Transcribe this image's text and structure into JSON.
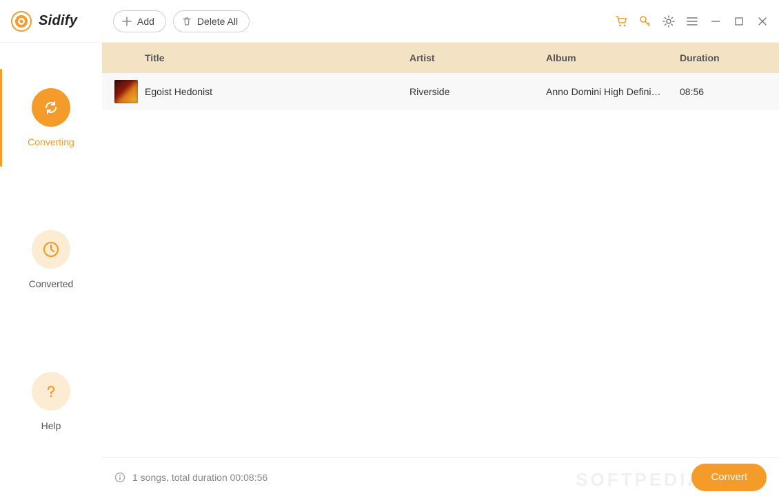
{
  "app": {
    "name": "Sidify"
  },
  "toolbar": {
    "add_label": "Add",
    "delete_all_label": "Delete All"
  },
  "window_icons": {
    "cart": "cart-icon",
    "key": "key-icon",
    "settings": "gear-icon",
    "menu": "hamburger-icon",
    "minimize": "minimize-icon",
    "maximize": "maximize-icon",
    "close": "close-icon"
  },
  "sidebar": {
    "items": [
      {
        "id": "converting",
        "label": "Converting",
        "active": true
      },
      {
        "id": "converted",
        "label": "Converted",
        "active": false
      },
      {
        "id": "help",
        "label": "Help",
        "active": false
      }
    ]
  },
  "columns": {
    "title": "Title",
    "artist": "Artist",
    "album": "Album",
    "duration": "Duration"
  },
  "tracks": [
    {
      "title": "Egoist Hedonist",
      "artist": "Riverside",
      "album": "Anno Domini High Defini…",
      "duration": "08:56"
    }
  ],
  "footer": {
    "summary": "1 songs, total duration 00:08:56",
    "convert_label": "Convert"
  },
  "watermark": "SOFTPEDIA",
  "colors": {
    "accent": "#f59b29",
    "accent_light": "#fdecd4",
    "header_band": "#f3e3c4"
  }
}
